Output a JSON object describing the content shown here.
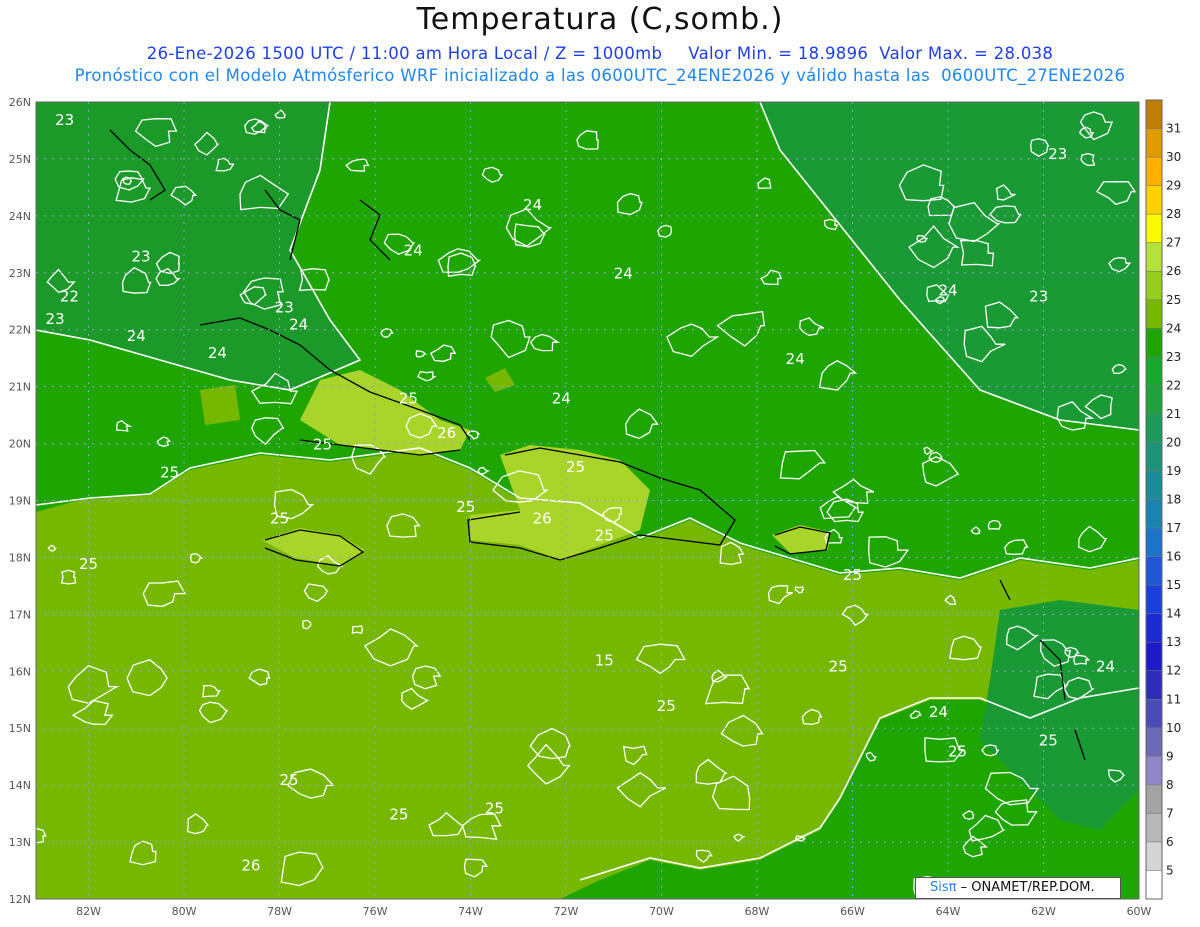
{
  "header": {
    "title": "Temperatura (C,somb.)",
    "subtitle_left": "26-Ene-2026 1500 UTC / 11:00 am Hora Local / Z = 1000mb",
    "subtitle_right": "Valor Min. = 18.9896  Valor Max. = 28.038",
    "subtitle_2": "Pronóstico con el Modelo Atmósferico WRF inicializado a las 0600UTC_24ENE2026 y válido hasta las  0600UTC_27ENE2026"
  },
  "credit": {
    "brand": "Sisπ",
    "text": "– ONAMET/REP.DOM."
  },
  "map": {
    "lat_range": [
      12,
      26
    ],
    "lon_range": [
      -83.1,
      -60
    ],
    "lat_labels": [
      "12N",
      "13N",
      "14N",
      "15N",
      "16N",
      "17N",
      "18N",
      "19N",
      "20N",
      "21N",
      "22N",
      "23N",
      "24N",
      "25N",
      "26N"
    ],
    "lon_labels": [
      "82W",
      "80W",
      "78W",
      "76W",
      "74W",
      "72W",
      "70W",
      "68W",
      "66W",
      "64W",
      "62W",
      "60W"
    ],
    "grid": true,
    "colors": {
      "warm": "#76b800",
      "mid": "#1fa500",
      "cool": "#1b9a2a",
      "land": "#a9d52b",
      "contour": "#ffffff",
      "coast": "#000000"
    },
    "contour_labels": [
      {
        "t": "23",
        "lon": -82.5,
        "lat": 25.6
      },
      {
        "t": "23",
        "lon": -80.9,
        "lat": 23.2
      },
      {
        "t": "22",
        "lon": -82.4,
        "lat": 22.5
      },
      {
        "t": "23",
        "lon": -82.7,
        "lat": 22.1
      },
      {
        "t": "24",
        "lon": -81.0,
        "lat": 21.8
      },
      {
        "t": "24",
        "lon": -79.3,
        "lat": 21.5
      },
      {
        "t": "23",
        "lon": -77.9,
        "lat": 22.3
      },
      {
        "t": "24",
        "lon": -77.6,
        "lat": 22.0
      },
      {
        "t": "24",
        "lon": -75.2,
        "lat": 23.3
      },
      {
        "t": "24",
        "lon": -72.7,
        "lat": 24.1
      },
      {
        "t": "24",
        "lon": -70.8,
        "lat": 22.9
      },
      {
        "t": "24",
        "lon": -72.1,
        "lat": 20.7
      },
      {
        "t": "25",
        "lon": -75.3,
        "lat": 20.7
      },
      {
        "t": "26",
        "lon": -74.5,
        "lat": 20.1
      },
      {
        "t": "25",
        "lon": -77.1,
        "lat": 19.9
      },
      {
        "t": "25",
        "lon": -80.3,
        "lat": 19.4
      },
      {
        "t": "25",
        "lon": -74.1,
        "lat": 18.8
      },
      {
        "t": "25",
        "lon": -71.8,
        "lat": 19.5
      },
      {
        "t": "26",
        "lon": -72.5,
        "lat": 18.6
      },
      {
        "t": "25",
        "lon": -71.2,
        "lat": 18.3
      },
      {
        "t": "25",
        "lon": -78.0,
        "lat": 18.6
      },
      {
        "t": "25",
        "lon": -82.0,
        "lat": 17.8
      },
      {
        "t": "25",
        "lon": -66.0,
        "lat": 17.6
      },
      {
        "t": "25",
        "lon": -69.9,
        "lat": 15.3
      },
      {
        "t": "25",
        "lon": -66.3,
        "lat": 16.0
      },
      {
        "t": "24",
        "lon": -64.2,
        "lat": 15.2
      },
      {
        "t": "25",
        "lon": -63.8,
        "lat": 14.5
      },
      {
        "t": "25",
        "lon": -61.9,
        "lat": 14.7
      },
      {
        "t": "24",
        "lon": -60.7,
        "lat": 16.0
      },
      {
        "t": "25",
        "lon": -77.8,
        "lat": 14.0
      },
      {
        "t": "25",
        "lon": -75.5,
        "lat": 13.4
      },
      {
        "t": "25",
        "lon": -73.5,
        "lat": 13.5
      },
      {
        "t": "26",
        "lon": -78.6,
        "lat": 12.5
      },
      {
        "t": "24",
        "lon": -67.2,
        "lat": 21.4
      },
      {
        "t": "24",
        "lon": -64.0,
        "lat": 22.6
      },
      {
        "t": "23",
        "lon": -62.1,
        "lat": 22.5
      },
      {
        "t": "23",
        "lon": -61.7,
        "lat": 25.0
      },
      {
        "t": "15",
        "lon": -71.2,
        "lat": 16.1
      }
    ]
  },
  "colorbar": {
    "levels": [
      "31",
      "30",
      "29",
      "28",
      "27",
      "26",
      "25",
      "24",
      "23",
      "22",
      "21",
      "20",
      "19",
      "18",
      "17",
      "16",
      "15",
      "14",
      "13",
      "12",
      "11",
      "10",
      "9",
      "8",
      "7",
      "6",
      "5"
    ],
    "colors": [
      "#c07e00",
      "#e19a00",
      "#ffb000",
      "#ffd200",
      "#fbfb00",
      "#b5e13c",
      "#98ce1d",
      "#76b800",
      "#1fa500",
      "#15a92e",
      "#1fa13c",
      "#1b9a5a",
      "#1d947a",
      "#1a8c99",
      "#1a84b0",
      "#1c74c8",
      "#1f57d7",
      "#1a40dc",
      "#1a2bd3",
      "#1b1bc7",
      "#2c2cb9",
      "#4a4ab8",
      "#6a6ab8",
      "#8f86c5",
      "#a3a3a3",
      "#b8b8b8",
      "#d4d4d4",
      "#ffffff"
    ]
  }
}
